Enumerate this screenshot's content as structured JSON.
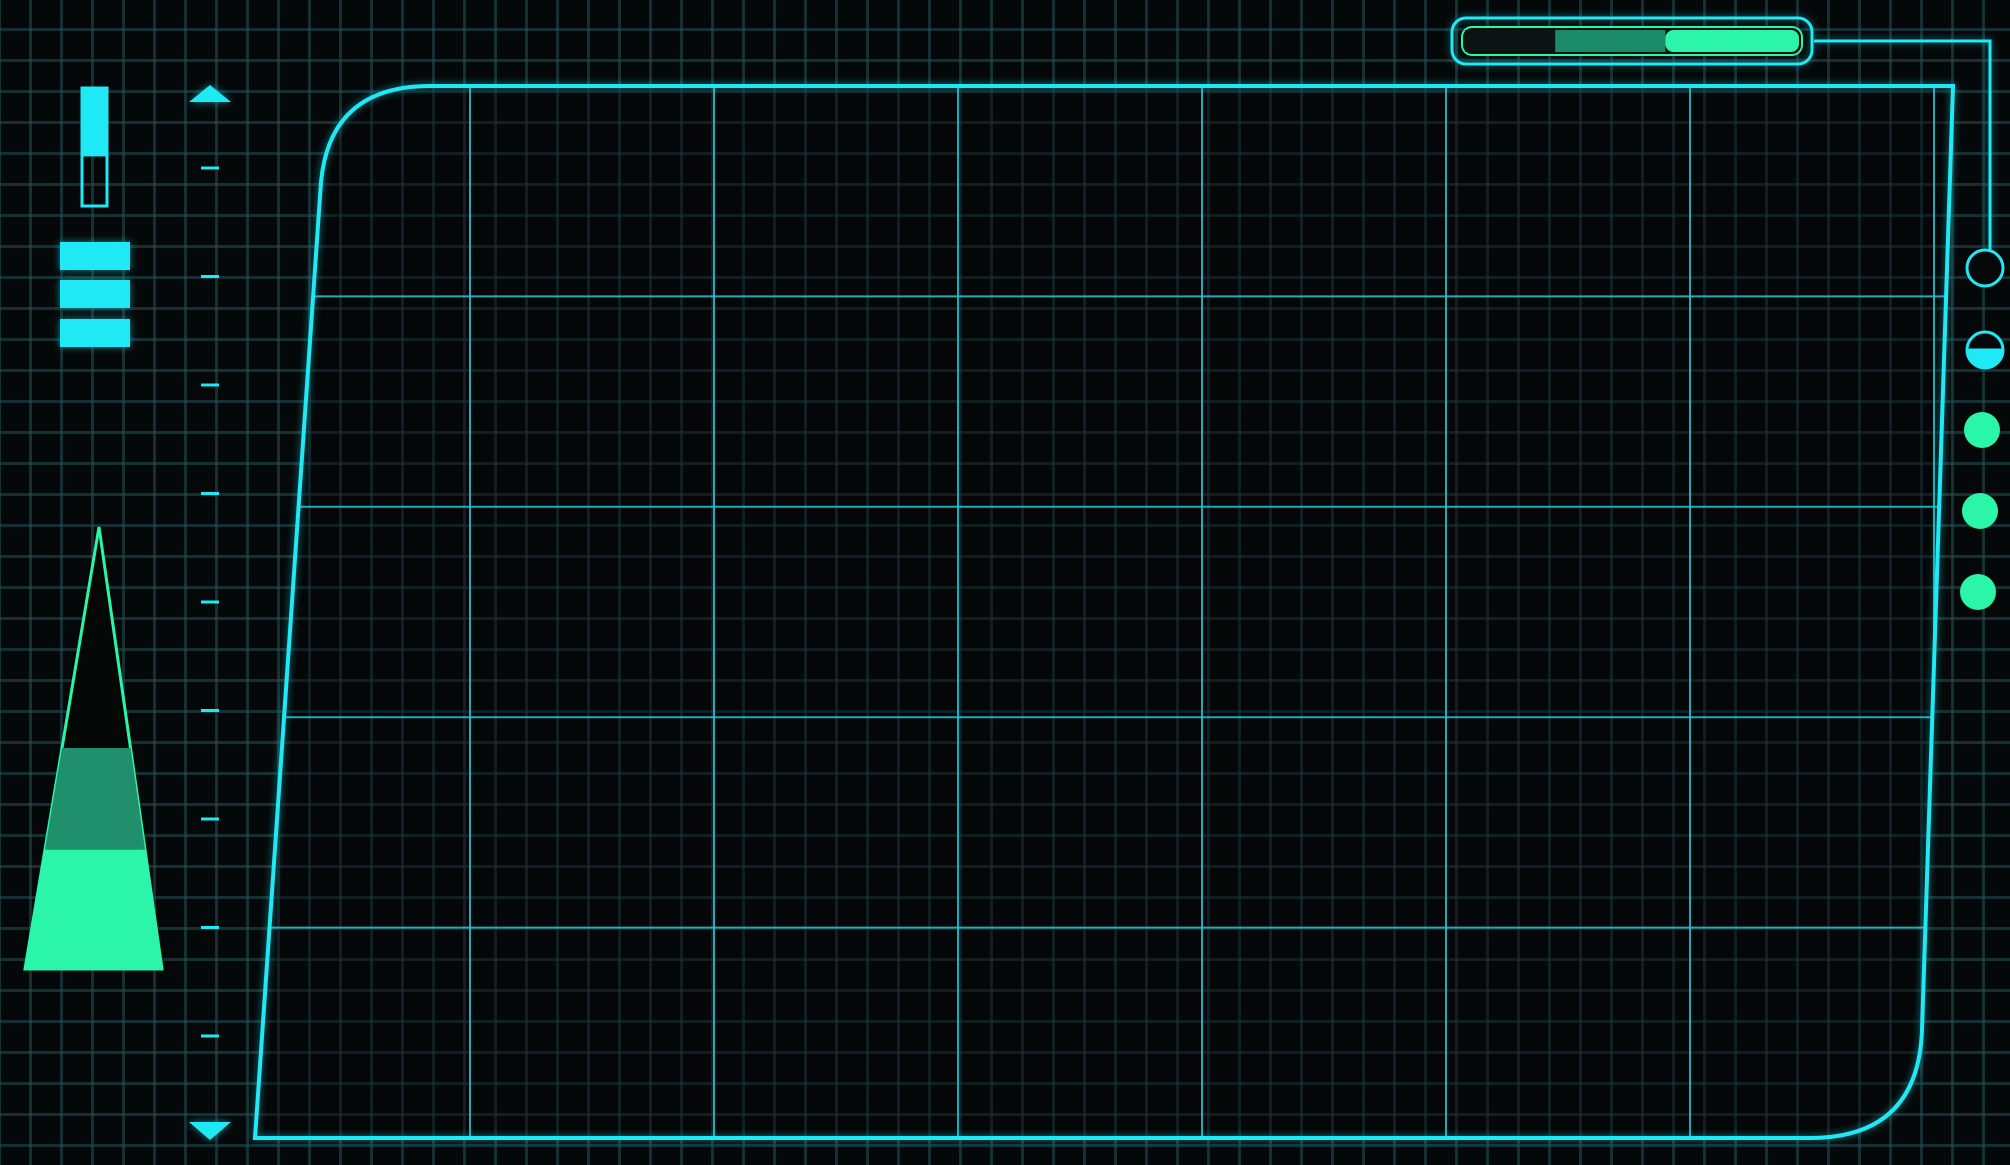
{
  "colors": {
    "background": "#050809",
    "grid_faint": "#244e56",
    "frame": "#1fe9f5",
    "frame_grid": "#23c8d6",
    "accent_green": "#2af5a8",
    "accent_green_dim": "#1a8a68",
    "dark": "#0b1412"
  },
  "top_progress_bar": {
    "icon": "segmented-progress-bar",
    "segments": [
      {
        "state": "empty",
        "fraction": 0.27
      },
      {
        "state": "dim",
        "fraction": 0.33
      },
      {
        "state": "bright",
        "fraction": 0.4
      }
    ]
  },
  "left_small_gauge": {
    "icon": "vertical-level-indicator",
    "level": 0.42
  },
  "left_menu": {
    "icon": "hamburger-menu-icon"
  },
  "left_scale": {
    "icon": "vertical-tick-scale",
    "up_icon": "triangle-up-icon",
    "down_icon": "triangle-down-icon",
    "tick_count": 9
  },
  "left_cone_gauge": {
    "icon": "triangular-level-gauge",
    "bright_fraction": 0.27,
    "dim_fraction": 0.23
  },
  "right_indicators": [
    {
      "state": "outline",
      "icon": "ring-indicator-icon"
    },
    {
      "state": "half-filled",
      "icon": "half-circle-indicator-icon"
    },
    {
      "state": "filled",
      "icon": "dot-indicator-icon"
    },
    {
      "state": "filled",
      "icon": "dot-indicator-icon"
    },
    {
      "state": "filled",
      "icon": "dot-indicator-icon"
    }
  ],
  "main_panel": {
    "icon": "grid-display-panel",
    "columns": 7,
    "rows": 5
  }
}
